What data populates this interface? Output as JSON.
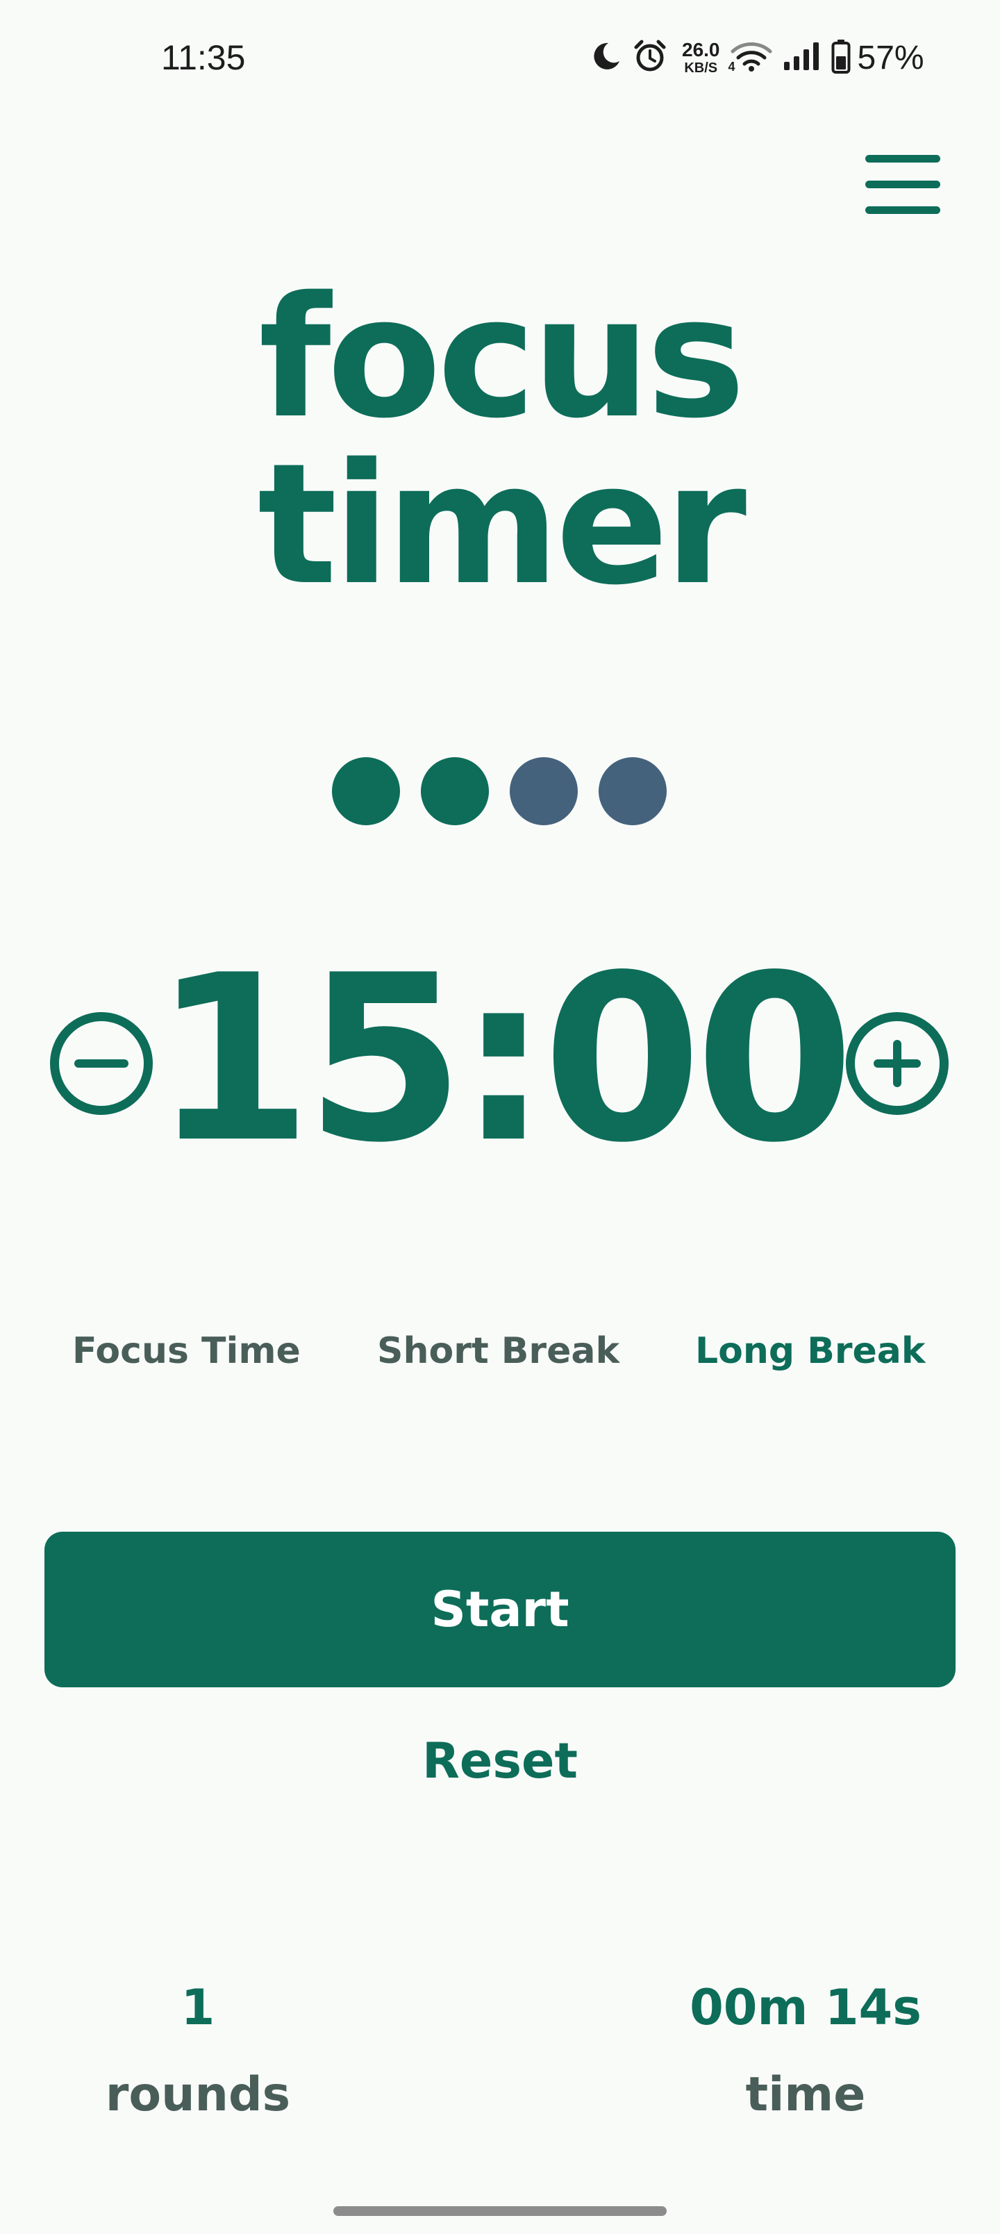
{
  "status_bar": {
    "time": "11:35",
    "net_speed_value": "26.0",
    "net_speed_unit": "KB/S",
    "network_type": "4",
    "battery_percent": "57%",
    "icons": [
      "moon-icon",
      "alarm-icon",
      "wifi-icon",
      "signal-icon",
      "battery-icon"
    ]
  },
  "menu": {
    "icon": "hamburger-menu-icon"
  },
  "title": {
    "line1": "focus",
    "line2": "timer"
  },
  "round_dots": {
    "total": 4,
    "completed": 2,
    "completed_color": "#0d6d59",
    "pending_color": "#45627d"
  },
  "timer": {
    "display": "15:00",
    "decrease_icon": "minus-circle-icon",
    "increase_icon": "plus-circle-icon"
  },
  "modes": {
    "items": [
      {
        "label": "Focus Time",
        "active": false
      },
      {
        "label": "Short Break",
        "active": false
      },
      {
        "label": "Long Break",
        "active": true
      }
    ]
  },
  "actions": {
    "start_label": "Start",
    "reset_label": "Reset"
  },
  "stats": {
    "rounds_value": "1",
    "rounds_label": "rounds",
    "time_value": "00m 14s",
    "time_label": "time"
  },
  "colors": {
    "accent": "#0d6d59",
    "muted_text": "#4a5e59",
    "background": "#f9fbf9"
  }
}
